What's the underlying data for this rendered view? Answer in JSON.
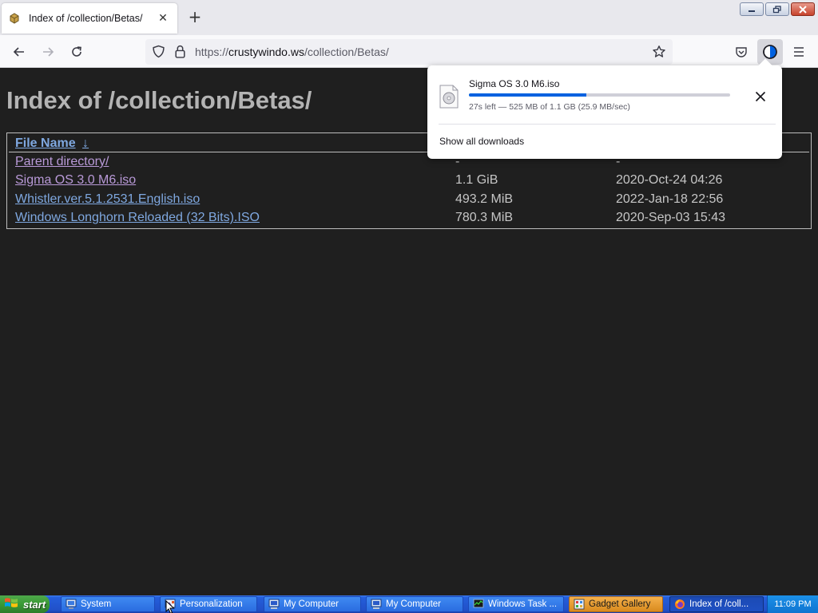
{
  "browser": {
    "tab": {
      "title": "Index of /collection/Betas/",
      "close_glyph": "✕",
      "favicon": "package-icon"
    },
    "new_tab_glyph": "+",
    "window_buttons": {
      "minimize": "minimize-icon",
      "restore": "restore-icon",
      "close": "close-icon"
    },
    "url": {
      "scheme": "https://",
      "host": "crustywindo.ws",
      "path": "/collection/Betas/"
    },
    "toolbar_icons": [
      "back-icon",
      "forward-icon",
      "reload-icon",
      "shield-icon",
      "lock-icon",
      "bookmark-star-icon",
      "pocket-icon",
      "downloads-icon",
      "menu-icon"
    ],
    "accent_color": "#0061e0"
  },
  "page": {
    "heading": "Index of /collection/Betas/",
    "table": {
      "header": {
        "name": "File Name",
        "sort_indicator": "↓"
      },
      "parent": {
        "name": "Parent directory/",
        "size": "-",
        "date": "-"
      },
      "rows": [
        {
          "name": "Sigma OS 3.0 M6.iso",
          "size": "1.1 GiB",
          "date": "2020-Oct-24 04:26"
        },
        {
          "name": "Whistler.ver.5.1.2531.English.iso",
          "size": "493.2 MiB",
          "date": "2022-Jan-18 22:56"
        },
        {
          "name": "Windows Longhorn Reloaded (32 Bits).ISO",
          "size": "780.3 MiB",
          "date": "2020-Sep-03 15:43"
        }
      ]
    },
    "link_color": "#7fa8e0",
    "visited_color": "#b99ad8"
  },
  "downloads_panel": {
    "file_name": "Sigma OS 3.0 M6.iso",
    "status": "27s left — 525 MB of 1.1 GB (25.9 MB/sec)",
    "progress_percent": 45,
    "show_all_label": "Show all downloads",
    "cancel_glyph": "✕"
  },
  "taskbar": {
    "start_label": "start",
    "items": [
      {
        "label": "System",
        "icon": "system-icon",
        "state": "normal"
      },
      {
        "label": "Personalization",
        "icon": "personalization-icon",
        "state": "normal"
      },
      {
        "label": "My Computer",
        "icon": "my-computer-icon",
        "state": "normal"
      },
      {
        "label": "My Computer",
        "icon": "my-computer-icon",
        "state": "normal"
      },
      {
        "label": "Windows Task ...",
        "icon": "task-manager-icon",
        "state": "normal"
      },
      {
        "label": "Gadget Gallery",
        "icon": "gadget-icon",
        "state": "flash"
      },
      {
        "label": "Index of /coll...",
        "icon": "firefox-icon",
        "state": "active"
      }
    ],
    "clock": "11:09 PM"
  }
}
